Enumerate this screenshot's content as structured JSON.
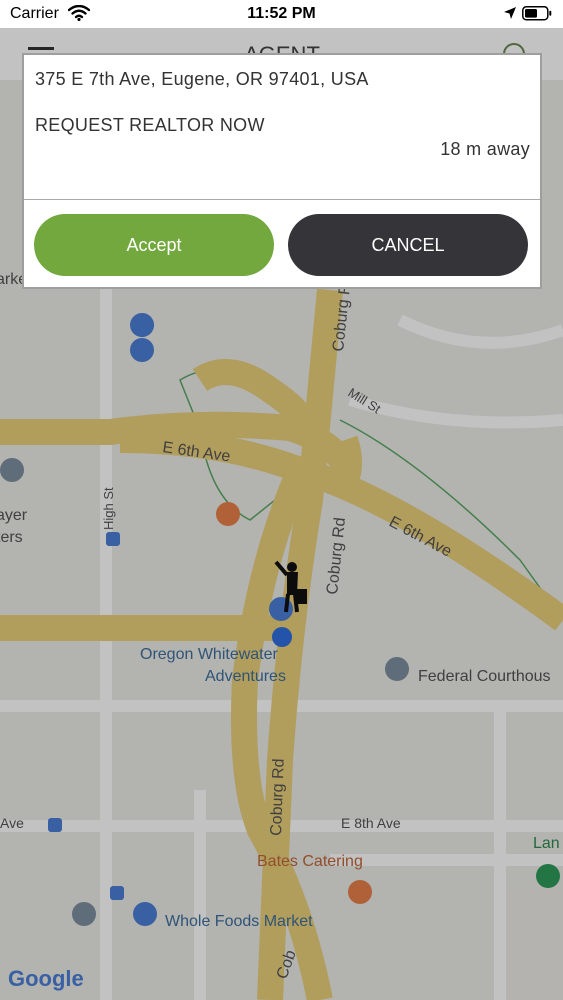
{
  "status_bar": {
    "carrier": "Carrier",
    "time": "11:52 PM",
    "icons": [
      "wifi-icon",
      "location-arrow-icon",
      "battery-icon"
    ]
  },
  "nav": {
    "title": "AGENT",
    "icons": [
      "menu-icon",
      "timer-icon"
    ]
  },
  "dialog": {
    "address": "375 E 7th Ave, Eugene, OR 97401, USA",
    "request_label": "REQUEST REALTOR NOW",
    "distance": "18 m away",
    "accept_label": "Accept",
    "cancel_label": "CANCEL"
  },
  "map": {
    "labels": {
      "coburg_top": "Coburg R",
      "mill_st": "Mill St",
      "e6th_left": "E 6th Ave",
      "e6th_right": "E 6th Ave",
      "high_st": "High St",
      "coburg_mid": "Coburg Rd",
      "coburg_low": "Coburg Rd",
      "oregon_1": "Oregon Whitewater",
      "oregon_2": "Adventures",
      "federal": "Federal Courthous",
      "ave_left": "Ave",
      "e8th": "E 8th Ave",
      "bates": "Bates Catering",
      "whole_foods": "Whole Foods Market",
      "lan": "Lan",
      "ayer": "ayer",
      "ters": "ters",
      "arke": "arke",
      "cob_bottom": "Cob",
      "google": "Google"
    },
    "colors": {
      "road_major": "#f3d57b",
      "road_minor": "#ffffff",
      "park_outline": "#5aa864",
      "poi_blue": "#4a7fd6",
      "poi_orange": "#e9804a",
      "poi_grey": "#7d8fa0",
      "poi_green": "#2e9a58",
      "accept": "#72a83e",
      "cancel": "#353438"
    }
  }
}
